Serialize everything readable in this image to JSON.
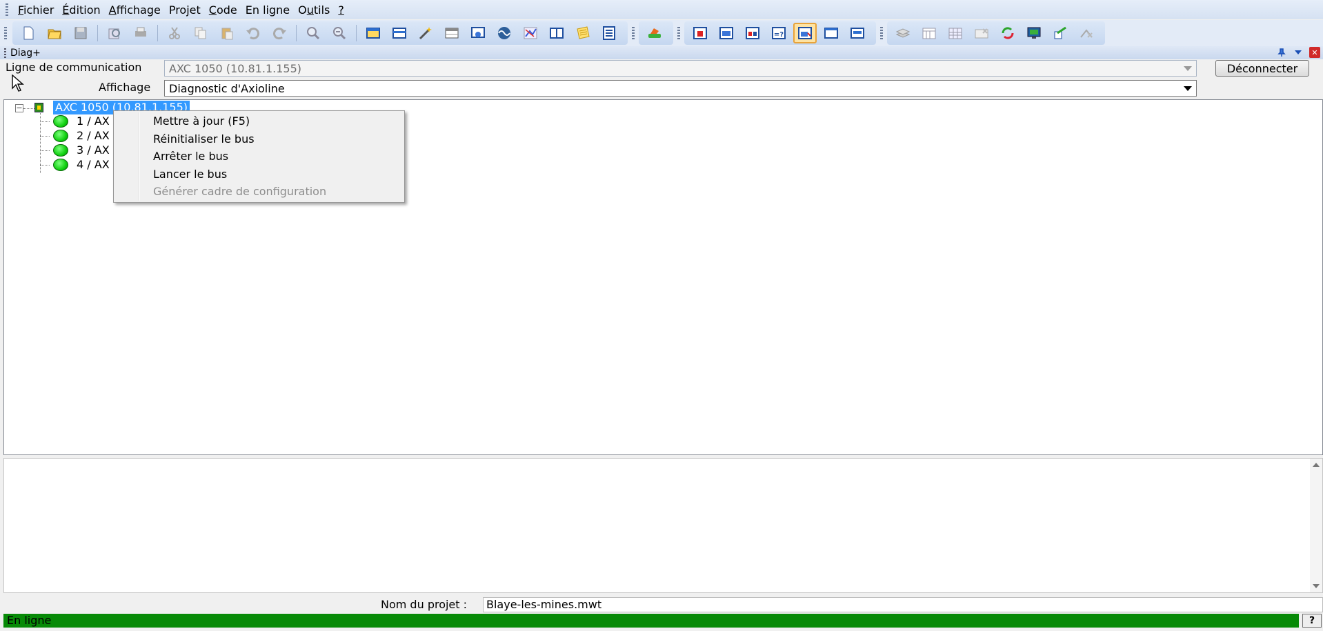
{
  "menu": [
    {
      "pre": "",
      "ul": "F",
      "post": "ichier"
    },
    {
      "pre": "",
      "ul": "É",
      "post": "dition"
    },
    {
      "pre": "",
      "ul": "A",
      "post": "ffichage"
    },
    {
      "pre": "Pro",
      "ul": "j",
      "post": "et"
    },
    {
      "pre": "",
      "ul": "C",
      "post": "ode"
    },
    {
      "pre": "En li",
      "ul": "g",
      "post": "ne"
    },
    {
      "pre": "O",
      "ul": "u",
      "post": "tils"
    },
    {
      "pre": "",
      "ul": "?",
      "post": ""
    }
  ],
  "panel": {
    "title": "Diag+"
  },
  "connection": {
    "line_label": "Ligne de communication",
    "line_value": "AXC 1050 (10.81.1.155)",
    "disconnect_label": "Déconnecter",
    "view_label": "Affichage",
    "view_value": "Diagnostic d'Axioline"
  },
  "tree": {
    "root": "AXC 1050 (10.81.1.155)",
    "nodes": [
      "1 / AX",
      "2 / AX",
      "3 / AX",
      "4 / AX"
    ]
  },
  "context_menu": {
    "items": [
      {
        "label": "Mettre à jour (F5)",
        "enabled": true
      },
      {
        "label": "Réinitialiser le bus",
        "enabled": true
      },
      {
        "label": "Arrêter le bus",
        "enabled": true
      },
      {
        "label": "Lancer le bus",
        "enabled": true
      },
      {
        "label": "Générer cadre de configuration",
        "enabled": false
      }
    ]
  },
  "project": {
    "label": "Nom du projet :",
    "value": "Blaye-les-mines.mwt"
  },
  "status": {
    "text": "En ligne",
    "help": "?",
    "color": "#078a07"
  },
  "toolbar": {
    "groups": [
      [
        "new-file-icon",
        "open-folder-icon",
        "save-icon",
        "print-preview-icon",
        "print-icon",
        "cut-icon",
        "copy-icon",
        "paste-icon",
        "undo-icon",
        "redo-icon",
        "zoom-in-icon",
        "zoom-out-icon",
        "window-icon",
        "panel-icon",
        "wand-icon",
        "table-icon",
        "view-icon",
        "wave-icon",
        "graph-icon",
        "columns-icon",
        "note-icon",
        "list-icon"
      ],
      [
        "tool-icon"
      ],
      [
        "red-module-icon",
        "blue-module-icon",
        "io-module-icon",
        "question-module-icon",
        "diag-icon",
        "blank-window-icon",
        "display-icon"
      ],
      [
        "stack-icon",
        "calendar-icon",
        "grid-icon",
        "disconnected-icon",
        "refresh-icon",
        "monitor-icon",
        "send-icon",
        "network-off-icon"
      ]
    ]
  }
}
